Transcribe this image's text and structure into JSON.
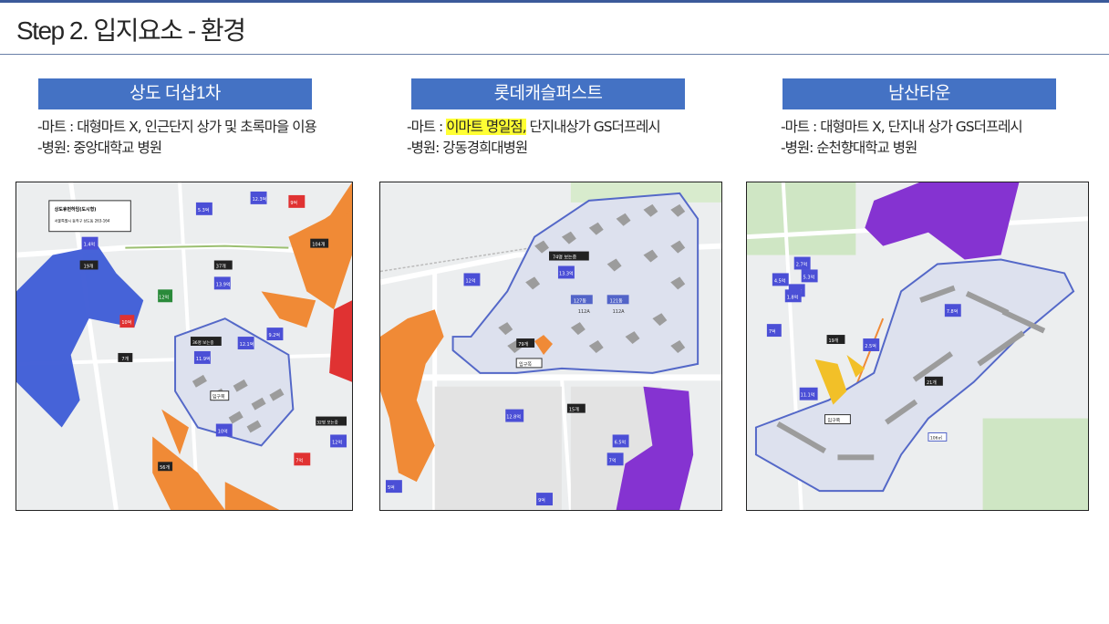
{
  "page": {
    "title": "Step 2. 입지요소 - 환경"
  },
  "columns": [
    {
      "name": "상도 더샵1차",
      "mart_prefix": "-마트 : 대형마트 X, 인근단지 상가 및 초록마을 이용",
      "hospital": "-병원: 중앙대학교 병원",
      "map": {
        "popup_title": "상도휴먼하임(도시형)",
        "popup_address": "서울특별시 동작구 상도동 263-164",
        "labels": [
          "19개",
          "1.4억",
          "5.3억",
          "12.3억",
          "10억",
          "13.9억",
          "12.1억",
          "9.2억",
          "12억",
          "10억",
          "11.9억",
          "7개",
          "36명 보는중",
          "10억",
          "37개",
          "104개",
          "32명 보는중",
          "12억",
          "9억",
          "7억",
          "56개",
          "입구쪽"
        ]
      }
    },
    {
      "name": "롯데캐슬퍼스트",
      "mart_prefix": "-마트 : ",
      "mart_highlight": "이마트 명일점,",
      "mart_suffix": " 단지내상가 GS더프레시",
      "hospital": "-병원: 강동경희대병원",
      "map": {
        "labels": [
          "74명 보는중",
          "12억",
          "13.3억",
          "127동",
          "121동",
          "112A",
          "112A",
          "79개",
          "입구쪽",
          "15개",
          "12.8억",
          "6.5억",
          "7억",
          "5억",
          "9억"
        ]
      }
    },
    {
      "name": "남산타운",
      "mart_prefix": "-마트 : 대형마트 X, 단지내 상가 GS더프레시",
      "hospital": "-병원: 순천향대학교 병원",
      "map": {
        "labels": [
          "2.7억",
          "5.3억",
          "4.5억",
          "5.3억",
          "1.8억",
          "19개",
          "2.5억",
          "11.1억",
          "7억",
          "7.8억",
          "21개",
          "입구쪽",
          "106㎡"
        ]
      }
    }
  ]
}
